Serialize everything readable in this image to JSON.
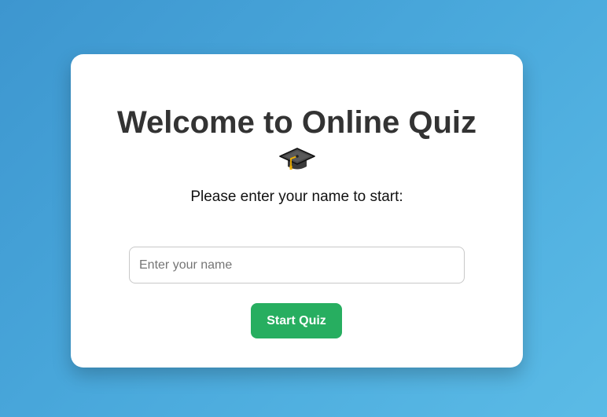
{
  "quiz": {
    "title": "Welcome to Online Quiz",
    "title_icon": "graduation-cap-icon",
    "prompt": "Please enter your name to start:",
    "name_input": {
      "value": "",
      "placeholder": "Enter your name"
    },
    "start_button_label": "Start Quiz"
  },
  "colors": {
    "background_gradient": [
      "#3d96cf",
      "#5bbbe6"
    ],
    "card": "#ffffff",
    "title_text": "#333333",
    "button": "#27ae60",
    "button_text": "#ffffff"
  }
}
